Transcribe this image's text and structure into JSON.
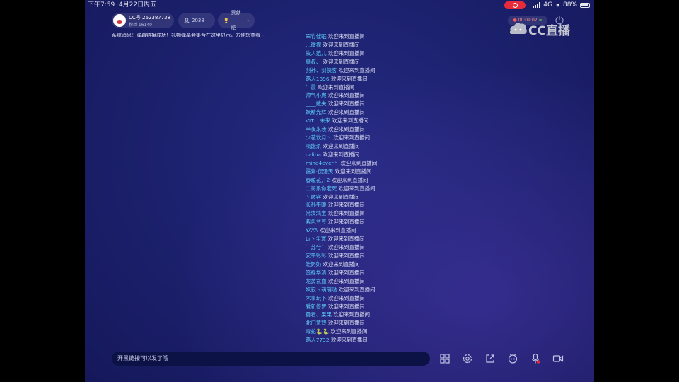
{
  "status_bar": {
    "time": "下午7:59",
    "date": "4月22日周五",
    "network": "4G",
    "battery": "88%",
    "battery_level": 0.88
  },
  "header": {
    "anchor_name": "CC号 262387738",
    "anchor_fans": "粉丝 16140",
    "viewers": "2038",
    "viewers_icon": "person-icon",
    "rank_label": "贡献榜",
    "rank_icon": "trophy-icon",
    "timer": "00:09:02",
    "logo_text": "CC直播"
  },
  "system_message": "系统消息：弹幕链接成功！礼物弹幕会集合在这里显示，方便您查看~",
  "welcome_text": "欢迎来到直播间",
  "feed": [
    {
      "nick": "翠竹催眠"
    },
    {
      "nick": "…微视"
    },
    {
      "nick": "牧人范儿"
    },
    {
      "nick": "皇叔、"
    },
    {
      "nick": "剑神、剑侠客"
    },
    {
      "nick": "路人1396"
    },
    {
      "nick": "゛晨"
    },
    {
      "nick": "帅气小虎"
    },
    {
      "nick": "____戴夫"
    },
    {
      "nick": "妖精光辉"
    },
    {
      "nick": "VIT....未来"
    },
    {
      "nick": "半夜来袭"
    },
    {
      "nick": "少花饮月丶"
    },
    {
      "nick": "陨能杀"
    },
    {
      "nick": "caliba"
    },
    {
      "nick": "mine4ever丶"
    },
    {
      "nick": "霞紫·侃漫天"
    },
    {
      "nick": "春暖花开2"
    },
    {
      "nick": "二哥系你老死"
    },
    {
      "nick": "丶骸客"
    },
    {
      "nick": "长孙平暖"
    },
    {
      "nick": "常演鸿宝"
    },
    {
      "nick": "紫色兰豆"
    },
    {
      "nick": "YAYA"
    },
    {
      "nick": "Lr丶尘寰"
    },
    {
      "nick": "゛苏兮゛"
    },
    {
      "nick": "安平彩彩"
    },
    {
      "nick": "娃奶奶"
    },
    {
      "nick": "签禄华清"
    },
    {
      "nick": "龙黄玄血"
    },
    {
      "nick": "妖寂丶萌萌哒"
    },
    {
      "nick": "木事玩下"
    },
    {
      "nick": "爱新修罗"
    },
    {
      "nick": "勇者、果果"
    },
    {
      "nick": "北门意智"
    },
    {
      "nick": "毒蛇🐍🐍"
    },
    {
      "nick": "路人7732"
    }
  ],
  "input": {
    "text": "开黑链接可以发了哦"
  },
  "toolbar": [
    {
      "name": "grid-icon"
    },
    {
      "name": "settings-icon"
    },
    {
      "name": "share-icon"
    },
    {
      "name": "game-icon"
    },
    {
      "name": "microphone-icon"
    },
    {
      "name": "camera-icon"
    }
  ],
  "colors": {
    "accent_nick": "#5ec8f5",
    "record": "#e62b3a",
    "background": "#1d2270"
  }
}
